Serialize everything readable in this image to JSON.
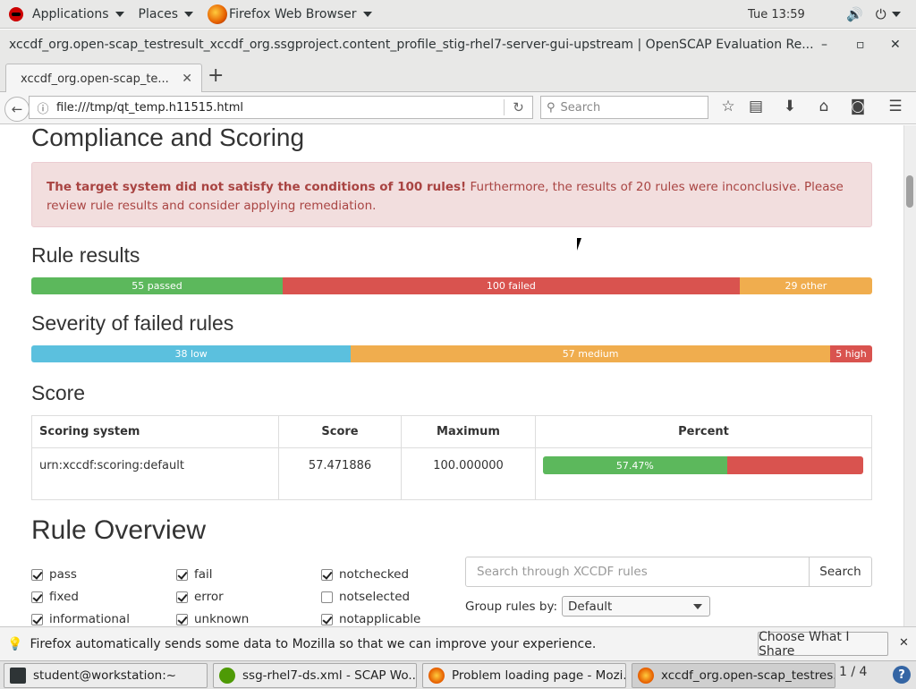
{
  "topbar": {
    "applications": "Applications",
    "places": "Places",
    "active_app": "Firefox Web Browser",
    "clock": "Tue 13:59"
  },
  "window": {
    "title": "xccdf_org.open-scap_testresult_xccdf_org.ssgproject.content_profile_stig-rhel7-server-gui-upstream | OpenSCAP Evaluation Re..."
  },
  "tabs": [
    {
      "label": "xccdf_org.open-scap_te..."
    }
  ],
  "navbar": {
    "url": "file:///tmp/qt_temp.h11515.html",
    "search_placeholder": "Search"
  },
  "page": {
    "compliance_heading": "Compliance and Scoring",
    "alert_bold": "The target system did not satisfy the conditions of 100 rules!",
    "alert_rest": " Furthermore, the results of 20 rules were inconclusive. Please review rule results and consider applying remediation.",
    "rule_results_heading": "Rule results",
    "rule_results": [
      {
        "label": "55 passed",
        "value": 55,
        "color": "#5cb85c"
      },
      {
        "label": "100 failed",
        "value": 100,
        "color": "#d9534f"
      },
      {
        "label": "29 other",
        "value": 29,
        "color": "#f0ad4e"
      }
    ],
    "severity_heading": "Severity of failed rules",
    "severity": [
      {
        "label": "38 low",
        "value": 38,
        "color": "#5bc0de"
      },
      {
        "label": "57 medium",
        "value": 57,
        "color": "#f0ad4e"
      },
      {
        "label": "5 high",
        "value": 5,
        "color": "#d9534f"
      }
    ],
    "score_heading": "Score",
    "score_table": {
      "headers": [
        "Scoring system",
        "Score",
        "Maximum",
        "Percent"
      ],
      "row": {
        "system": "urn:xccdf:scoring:default",
        "score": "57.471886",
        "maximum": "100.000000",
        "percent_label": "57.47%",
        "percent": 57.47
      }
    },
    "overview_heading": "Rule Overview",
    "filters": [
      {
        "label": "pass",
        "checked": true
      },
      {
        "label": "fail",
        "checked": true
      },
      {
        "label": "notchecked",
        "checked": true
      },
      {
        "label": "fixed",
        "checked": true
      },
      {
        "label": "error",
        "checked": true
      },
      {
        "label": "notselected",
        "checked": false
      },
      {
        "label": "informational",
        "checked": true
      },
      {
        "label": "unknown",
        "checked": true
      },
      {
        "label": "notapplicable",
        "checked": true
      }
    ],
    "rule_search_placeholder": "Search through XCCDF rules",
    "rule_search_button": "Search",
    "group_label": "Group rules by:",
    "group_value": "Default"
  },
  "notification": {
    "text": "Firefox automatically sends some data to Mozilla so that we can improve your experience.",
    "button": "Choose What I Share"
  },
  "taskbar": {
    "items": [
      {
        "label": "student@workstation:~"
      },
      {
        "label": "ssg-rhel7-ds.xml - SCAP Wo..."
      },
      {
        "label": "Problem loading page - Mozi..."
      },
      {
        "label": "xccdf_org.open-scap_testres..."
      }
    ],
    "pager": "1 / 4"
  }
}
